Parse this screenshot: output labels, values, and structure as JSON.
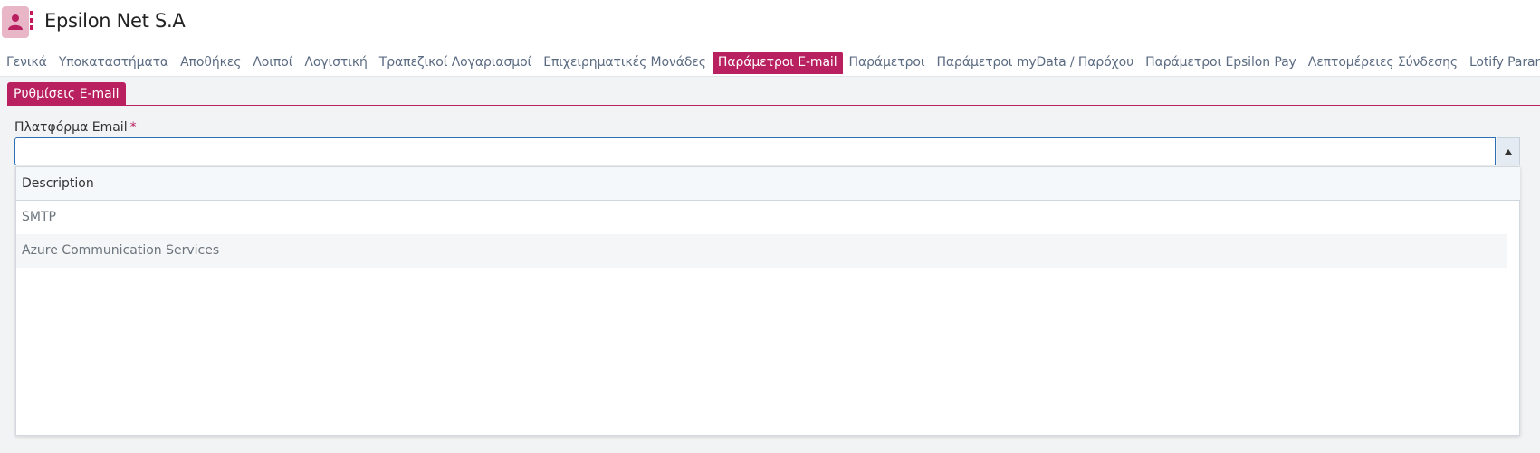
{
  "header": {
    "title": "Epsilon Net S.A",
    "entity_icon": "user-icon"
  },
  "tabs": [
    {
      "label": "Γενικά",
      "active": false
    },
    {
      "label": "Υποκαταστήματα",
      "active": false
    },
    {
      "label": "Αποθήκες",
      "active": false
    },
    {
      "label": "Λοιποί",
      "active": false
    },
    {
      "label": "Λογιστική",
      "active": false
    },
    {
      "label": "Τραπεζικοί Λογαριασμοί",
      "active": false
    },
    {
      "label": "Επιχειρηματικές Μονάδες",
      "active": false
    },
    {
      "label": "Παράμετροι E-mail",
      "active": true
    },
    {
      "label": "Παράμετροι",
      "active": false
    },
    {
      "label": "Παράμετροι myData / Παρόχου",
      "active": false
    },
    {
      "label": "Παράμετροι Epsilon Pay",
      "active": false
    },
    {
      "label": "Λεπτομέρειες Σύνδεσης",
      "active": false
    },
    {
      "label": "Lotify Parameters",
      "active": false
    }
  ],
  "subtab": {
    "label": "Ρυθμίσεις E-mail"
  },
  "email_platform": {
    "label": "Πλατφόρμα Email",
    "required_mark": "*",
    "value": "",
    "dropdown_icon": "triangle-up-icon"
  },
  "dropdown": {
    "column_header": "Description",
    "options": [
      "SMTP",
      "Azure Communication Services"
    ]
  },
  "colors": {
    "accent": "#b82060",
    "focus_border": "#2f6fb3",
    "tab_text": "#5b6b82"
  }
}
